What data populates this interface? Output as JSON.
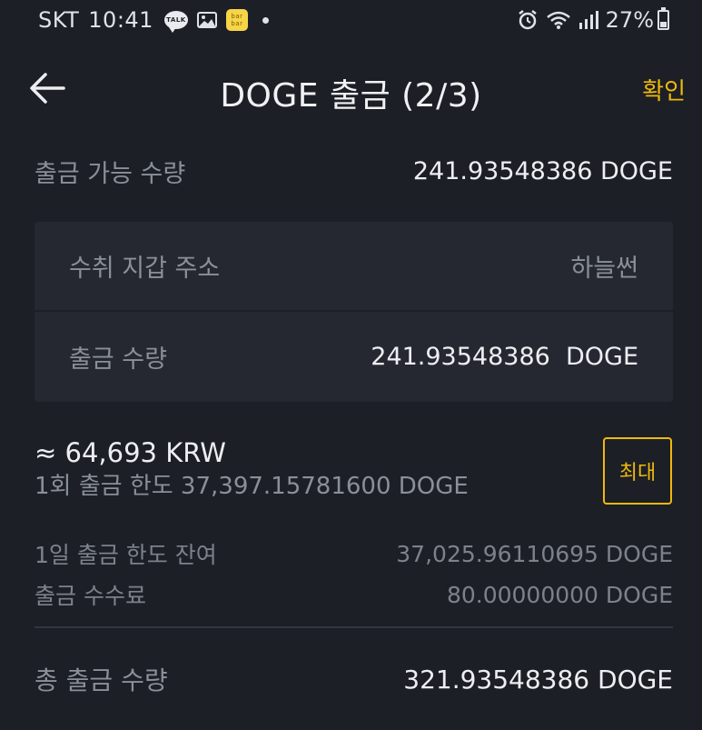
{
  "status_bar": {
    "carrier": "SKT",
    "time": "10:41",
    "talk_icon_text": "TALK",
    "bubble_icon_text": "bar bar",
    "battery": "27%"
  },
  "header": {
    "title": "DOGE 출금 (2/3)",
    "confirm_label": "확인"
  },
  "available": {
    "label": "출금 가능 수량",
    "value": "241.93548386 DOGE"
  },
  "panel": {
    "address_label": "수취 지갑 주소",
    "address_value": "하늘썬",
    "amount_label": "출금 수량",
    "amount_value": "241.93548386  DOGE"
  },
  "estimate": {
    "krw": "≈ 64,693 KRW",
    "per_withdraw_limit": "1회 출금 한도 37,397.15781600 DOGE"
  },
  "max_button_label": "최대",
  "daily_remaining": {
    "label": "1일 출금 한도 잔여",
    "value": "37,025.96110695 DOGE"
  },
  "fee": {
    "label": "출금 수수료",
    "value": "80.00000000 DOGE"
  },
  "total": {
    "label": "총 출금 수량",
    "value": "321.93548386 DOGE"
  },
  "colors": {
    "background": "#1c1f26",
    "panel": "#252831",
    "accent": "#f0b90b",
    "muted_text": "#8a9099"
  }
}
